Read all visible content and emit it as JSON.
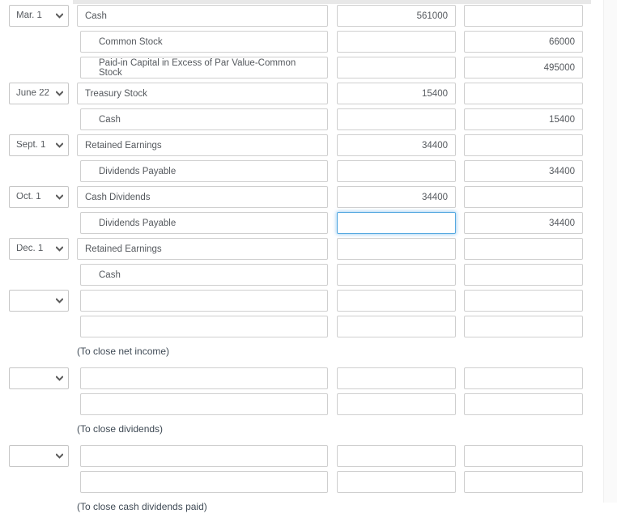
{
  "icons": {
    "chevron_down": "chevron-down-icon"
  },
  "colors": {
    "text": "#55595e",
    "border": "#cfcfcf",
    "focus_border": "#56a9e0",
    "focus_glow": "rgba(102,175,233,0.55)",
    "header_strip": "#e8e8e8",
    "gutter": "#fafafa"
  },
  "journal": {
    "rows": [
      {
        "kind": "entry",
        "date": "Mar. 1",
        "has_date": true,
        "account": "Cash",
        "indented": false,
        "debit": "561000",
        "credit": "",
        "focused": ""
      },
      {
        "kind": "entry",
        "date": "",
        "has_date": false,
        "account": "Common Stock",
        "indented": true,
        "debit": "",
        "credit": "66000",
        "focused": ""
      },
      {
        "kind": "entry",
        "date": "",
        "has_date": false,
        "account": "Paid-in Capital in Excess of Par Value-Common Stock",
        "indented": true,
        "debit": "",
        "credit": "495000",
        "focused": ""
      },
      {
        "kind": "entry",
        "date": "June 22",
        "has_date": true,
        "account": "Treasury Stock",
        "indented": false,
        "debit": "15400",
        "credit": "",
        "focused": ""
      },
      {
        "kind": "entry",
        "date": "",
        "has_date": false,
        "account": "Cash",
        "indented": true,
        "debit": "",
        "credit": "15400",
        "focused": ""
      },
      {
        "kind": "entry",
        "date": "Sept. 1",
        "has_date": true,
        "account": "Retained Earnings",
        "indented": false,
        "debit": "34400",
        "credit": "",
        "focused": ""
      },
      {
        "kind": "entry",
        "date": "",
        "has_date": false,
        "account": "Dividends Payable",
        "indented": true,
        "debit": "",
        "credit": "34400",
        "focused": ""
      },
      {
        "kind": "entry",
        "date": "Oct. 1",
        "has_date": true,
        "account": "Cash Dividends",
        "indented": false,
        "debit": "34400",
        "credit": "",
        "focused": ""
      },
      {
        "kind": "entry",
        "date": "",
        "has_date": false,
        "account": "Dividends Payable",
        "indented": true,
        "debit": "",
        "credit": "34400",
        "focused": "debit"
      },
      {
        "kind": "entry",
        "date": "Dec. 1",
        "has_date": true,
        "account": "Retained Earnings",
        "indented": false,
        "debit": "",
        "credit": "",
        "focused": ""
      },
      {
        "kind": "entry",
        "date": "",
        "has_date": false,
        "account": "Cash",
        "indented": true,
        "debit": "",
        "credit": "",
        "focused": ""
      },
      {
        "kind": "entry",
        "date": "",
        "has_date": true,
        "account": "",
        "indented": true,
        "debit": "",
        "credit": "",
        "focused": ""
      },
      {
        "kind": "entry",
        "date": "",
        "has_date": false,
        "account": "",
        "indented": true,
        "debit": "",
        "credit": "",
        "focused": ""
      },
      {
        "kind": "note",
        "note": "(To close net income)"
      },
      {
        "kind": "entry",
        "date": "",
        "has_date": true,
        "account": "",
        "indented": true,
        "debit": "",
        "credit": "",
        "focused": ""
      },
      {
        "kind": "entry",
        "date": "",
        "has_date": false,
        "account": "",
        "indented": true,
        "debit": "",
        "credit": "",
        "focused": ""
      },
      {
        "kind": "note",
        "note": "(To close dividends)"
      },
      {
        "kind": "entry",
        "date": "",
        "has_date": true,
        "account": "",
        "indented": true,
        "debit": "",
        "credit": "",
        "focused": ""
      },
      {
        "kind": "entry",
        "date": "",
        "has_date": false,
        "account": "",
        "indented": true,
        "debit": "",
        "credit": "",
        "focused": ""
      },
      {
        "kind": "note",
        "note": "(To close cash dividends paid)"
      }
    ]
  }
}
